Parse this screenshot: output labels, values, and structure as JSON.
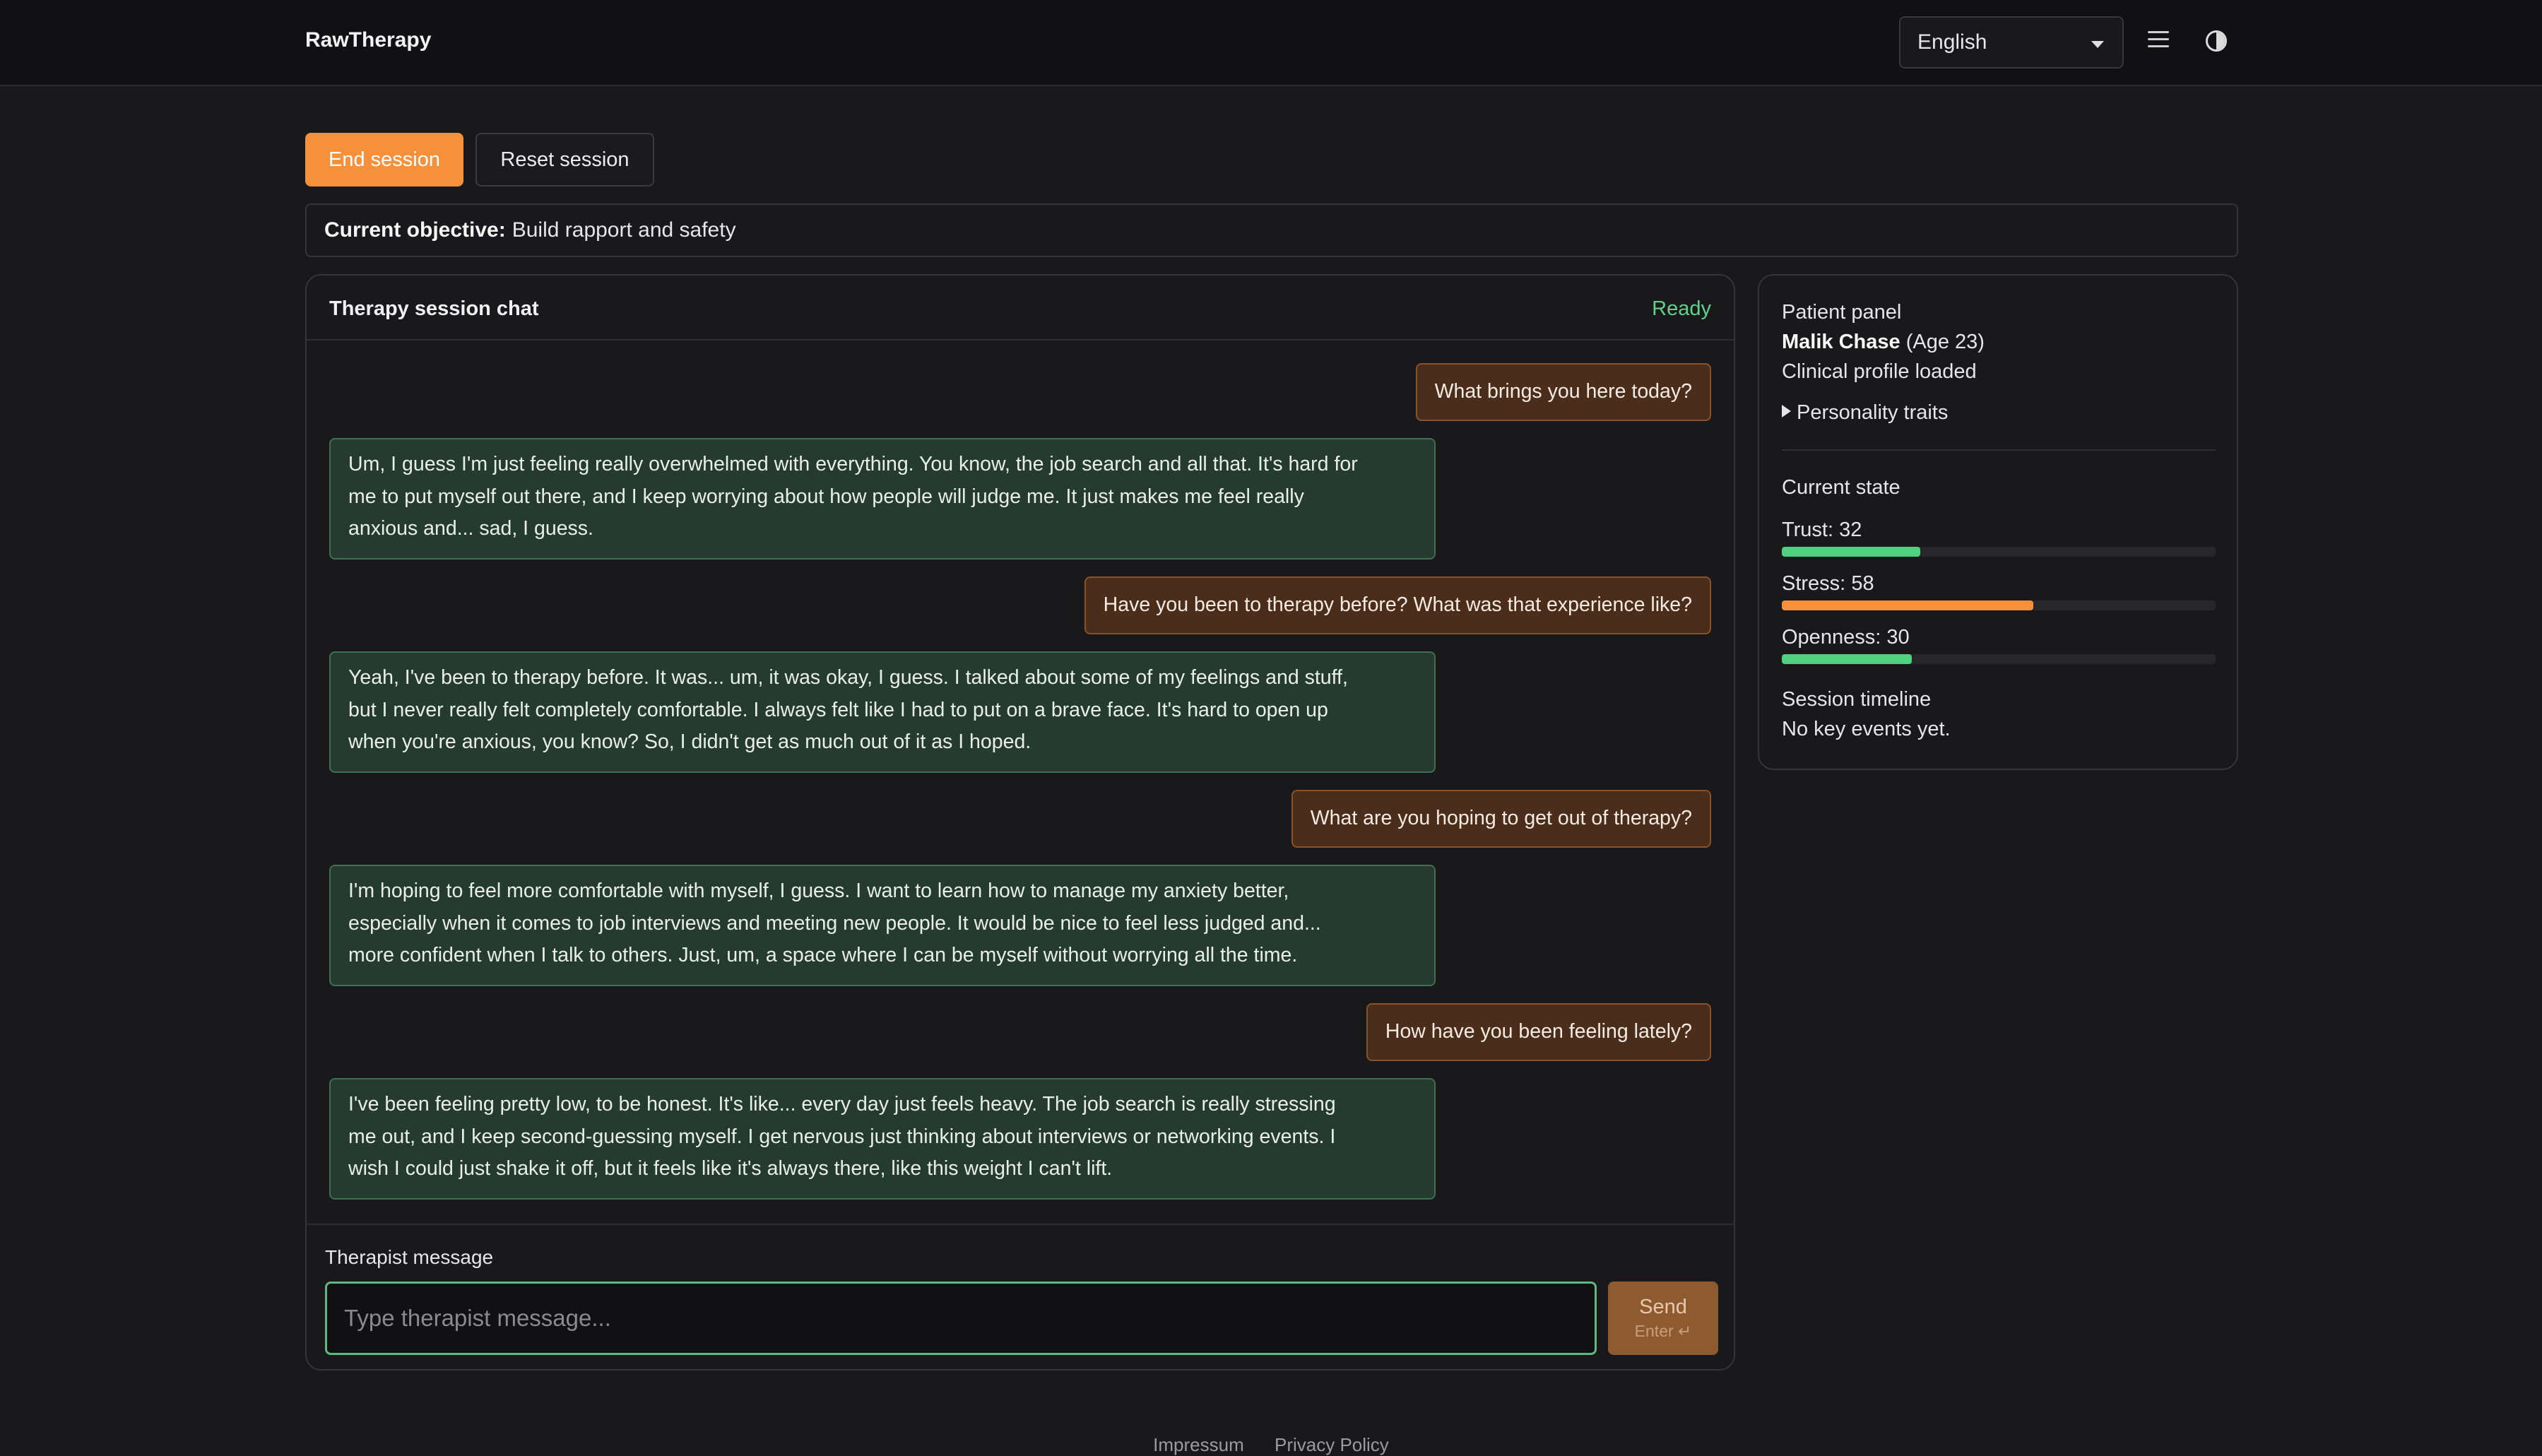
{
  "app": {
    "title": "RawTherapy"
  },
  "header": {
    "language": "English",
    "menu_icon": "hamburger-menu-icon",
    "theme_icon": "contrast-icon"
  },
  "actions": {
    "end_session": "End session",
    "reset_session": "Reset session"
  },
  "objective": {
    "label": "Current objective:",
    "value": "Build rapport and safety"
  },
  "chat": {
    "title": "Therapy session chat",
    "status": "Ready",
    "messages": [
      {
        "role": "therapist",
        "text": "What brings you here today?"
      },
      {
        "role": "patient",
        "text": "Um, I guess I'm just feeling really overwhelmed with everything. You know, the job search and all that. It's hard for\nme to put myself out there, and I keep worrying about how people will judge me. It just makes me feel really\nanxious and... sad, I guess."
      },
      {
        "role": "therapist",
        "text": "Have you been to therapy before? What was that experience like?"
      },
      {
        "role": "patient",
        "text": "Yeah, I've been to therapy before. It was... um, it was okay, I guess. I talked about some of my feelings and stuff,\nbut I never really felt completely comfortable. I always felt like I had to put on a brave face. It's hard to open up\nwhen you're anxious, you know? So, I didn't get as much out of it as I hoped."
      },
      {
        "role": "therapist",
        "text": "What are you hoping to get out of therapy?"
      },
      {
        "role": "patient",
        "text": "I'm hoping to feel more comfortable with myself, I guess. I want to learn how to manage my anxiety better,\nespecially when it comes to job interviews and meeting new people. It would be nice to feel less judged and...\nmore confident when I talk to others. Just, um, a space where I can be myself without worrying all the time."
      },
      {
        "role": "therapist",
        "text": "How have you been feeling lately?"
      },
      {
        "role": "patient",
        "text": "I've been feeling pretty low, to be honest. It's like... every day just feels heavy. The job search is really stressing\nme out, and I keep second-guessing myself. I get nervous just thinking about interviews or networking events. I\nwish I could just shake it off, but it feels like it's always there, like this weight I can't lift."
      }
    ],
    "input_label": "Therapist message",
    "input_placeholder": "Type therapist message...",
    "send_label": "Send",
    "send_hint": "Enter ↵"
  },
  "patient_panel": {
    "heading": "Patient panel",
    "name": "Malik Chase",
    "age": "(Age 23)",
    "profile_status": "Clinical profile loaded",
    "traits_toggle": "Personality traits",
    "state_heading": "Current state",
    "metrics": [
      {
        "label": "Trust:",
        "value": 32,
        "color": "#4fd17f"
      },
      {
        "label": "Stress:",
        "value": 58,
        "color": "#f6903a"
      },
      {
        "label": "Openness:",
        "value": 30,
        "color": "#4fd17f"
      }
    ],
    "timeline_heading": "Session timeline",
    "timeline_empty": "No key events yet."
  },
  "footer": {
    "links": [
      "Impressum",
      "Privacy Policy"
    ]
  },
  "colors": {
    "accent": "#f6903a",
    "ready": "#5fd38a",
    "patient_bubble": "#263b30",
    "therapist_bubble": "#4a2d1a"
  }
}
